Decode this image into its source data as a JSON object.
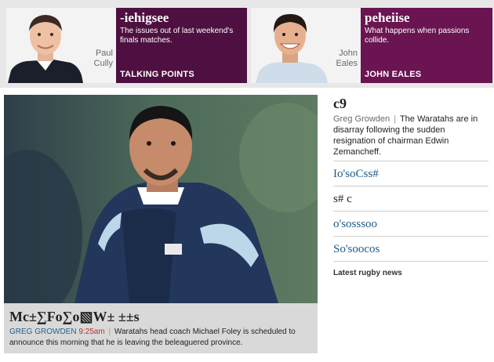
{
  "columnists": [
    {
      "name_first": "Paul",
      "name_last": "Cully",
      "title": "-iehigsee",
      "desc": "The issues out of last weekend's finals matches.",
      "tag": "TALKING POINTS"
    },
    {
      "name_first": "John",
      "name_last": "Eales",
      "title": "peheiise",
      "desc": "What happens when passions collide.",
      "tag": "JOHN EALES"
    }
  ],
  "lead": {
    "headline": "Mc±∑Fo∑o▧W± ±±s",
    "byline": "GREG GROWDEN",
    "time": "9:25am",
    "summary": "Waratahs head coach Michael Foley is scheduled to announce this morning that he is leaving the beleaguered province."
  },
  "side": {
    "title": "c9",
    "byline": "Greg Growden",
    "text": "The Waratahs are in disarray following the sudden resignation of chairman Edwin Zemancheff.",
    "links": [
      "Io'soCss#",
      "s# c",
      "o'sosssoo",
      "So'soocos"
    ],
    "footer": "Latest rugby news"
  },
  "colors": {
    "columnist_bg": "#4e1040",
    "columnist_bg_alt": "#6a1451",
    "link": "#1c5a88",
    "byline": "#20628b",
    "time": "#b0362c"
  }
}
